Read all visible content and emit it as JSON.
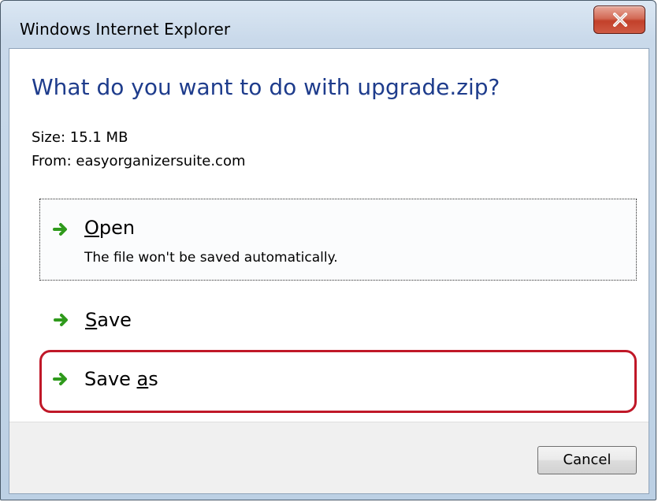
{
  "window": {
    "title": "Windows Internet Explorer"
  },
  "dialog": {
    "question": "What do you want to do with upgrade.zip?",
    "size_text": "Size: 15.1 MB",
    "from_text": "From: easyorganizersuite.com"
  },
  "options": {
    "open": {
      "label_first": "O",
      "label_rest": "pen",
      "description": "The file won't be saved automatically."
    },
    "save": {
      "label_first": "S",
      "label_rest": "ave"
    },
    "save_as": {
      "label_start": "Save ",
      "label_underlined": "a",
      "label_end": "s"
    }
  },
  "footer": {
    "cancel_label": "Cancel"
  },
  "icons": {
    "close": "close-icon",
    "option_arrow": "green-arrow-icon"
  },
  "colors": {
    "heading": "#1e3c8c",
    "highlight_border": "#c01828",
    "arrow_green": "#2f9a1c",
    "close_button": "#c2402a"
  }
}
